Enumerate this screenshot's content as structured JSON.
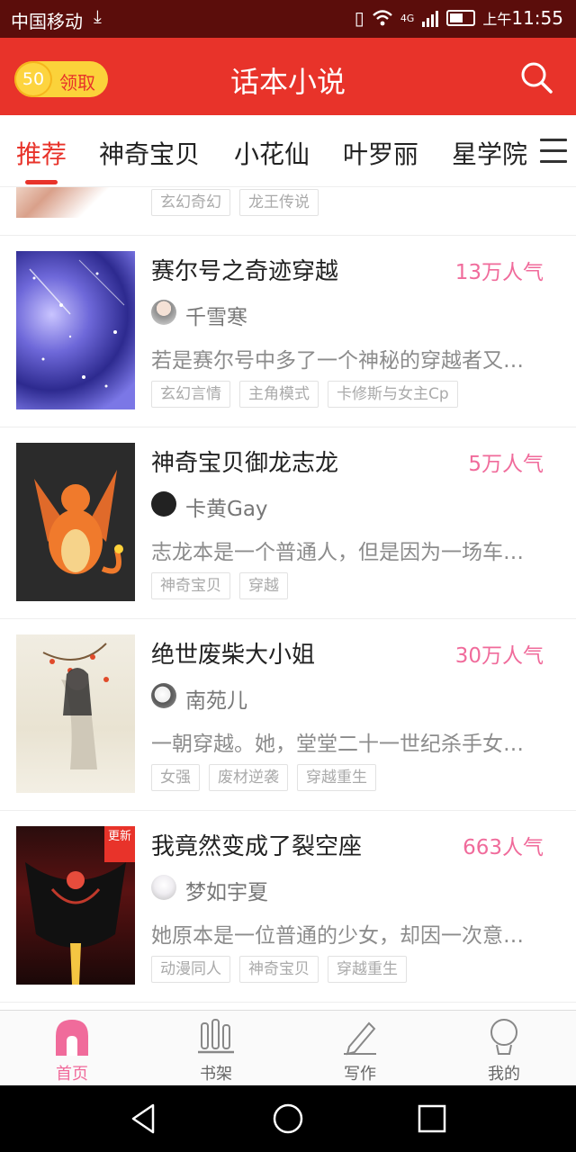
{
  "status_bar": {
    "carrier": "中国移动",
    "network": "4G",
    "time_prefix": "上午",
    "time": "11:55"
  },
  "app_bar": {
    "coin_value": "50",
    "coin_label": "领取",
    "title": "话本小说",
    "search_icon": "search-icon"
  },
  "tabs": [
    {
      "label": "推荐",
      "active": true
    },
    {
      "label": "神奇宝贝",
      "active": false
    },
    {
      "label": "小花仙",
      "active": false
    },
    {
      "label": "叶罗丽",
      "active": false
    },
    {
      "label": "星学院",
      "active": false
    }
  ],
  "partial_row": {
    "tags": [
      "玄幻奇幻",
      "龙王传说"
    ]
  },
  "books": [
    {
      "title": "赛尔号之奇迹穿越",
      "popularity": "13万人气",
      "author": "千雪寒",
      "description": "若是赛尔号中多了一个神秘的穿越者又…",
      "tags": [
        "玄幻言情",
        "主角模式",
        "卡修斯与女主Cp"
      ]
    },
    {
      "title": "神奇宝贝御龙志龙",
      "popularity": "5万人气",
      "author": "卡黄Gay",
      "description": "志龙本是一个普通人，但是因为一场车…",
      "tags": [
        "神奇宝贝",
        "穿越"
      ]
    },
    {
      "title": "绝世废柴大小姐",
      "popularity": "30万人气",
      "author": "南苑儿",
      "description": "一朝穿越。她，堂堂二十一世纪杀手女…",
      "tags": [
        "女强",
        "废材逆袭",
        "穿越重生"
      ]
    },
    {
      "title": "我竟然变成了裂空座",
      "popularity": "663人气",
      "author": "梦如宇夏",
      "description": "她原本是一位普通的少女，却因一次意…",
      "tags": [
        "动漫同人",
        "神奇宝贝",
        "穿越重生"
      ],
      "badge": "更新"
    }
  ],
  "bottom_nav": [
    {
      "label": "首页",
      "icon": "home-icon",
      "active": true
    },
    {
      "label": "书架",
      "icon": "bookshelf-icon",
      "active": false
    },
    {
      "label": "写作",
      "icon": "pencil-icon",
      "active": false
    },
    {
      "label": "我的",
      "icon": "profile-icon",
      "active": false
    }
  ],
  "colors": {
    "brand_red": "#e8332a",
    "popularity_pink": "#f06b9b",
    "coin_yellow": "#fbd23a"
  }
}
